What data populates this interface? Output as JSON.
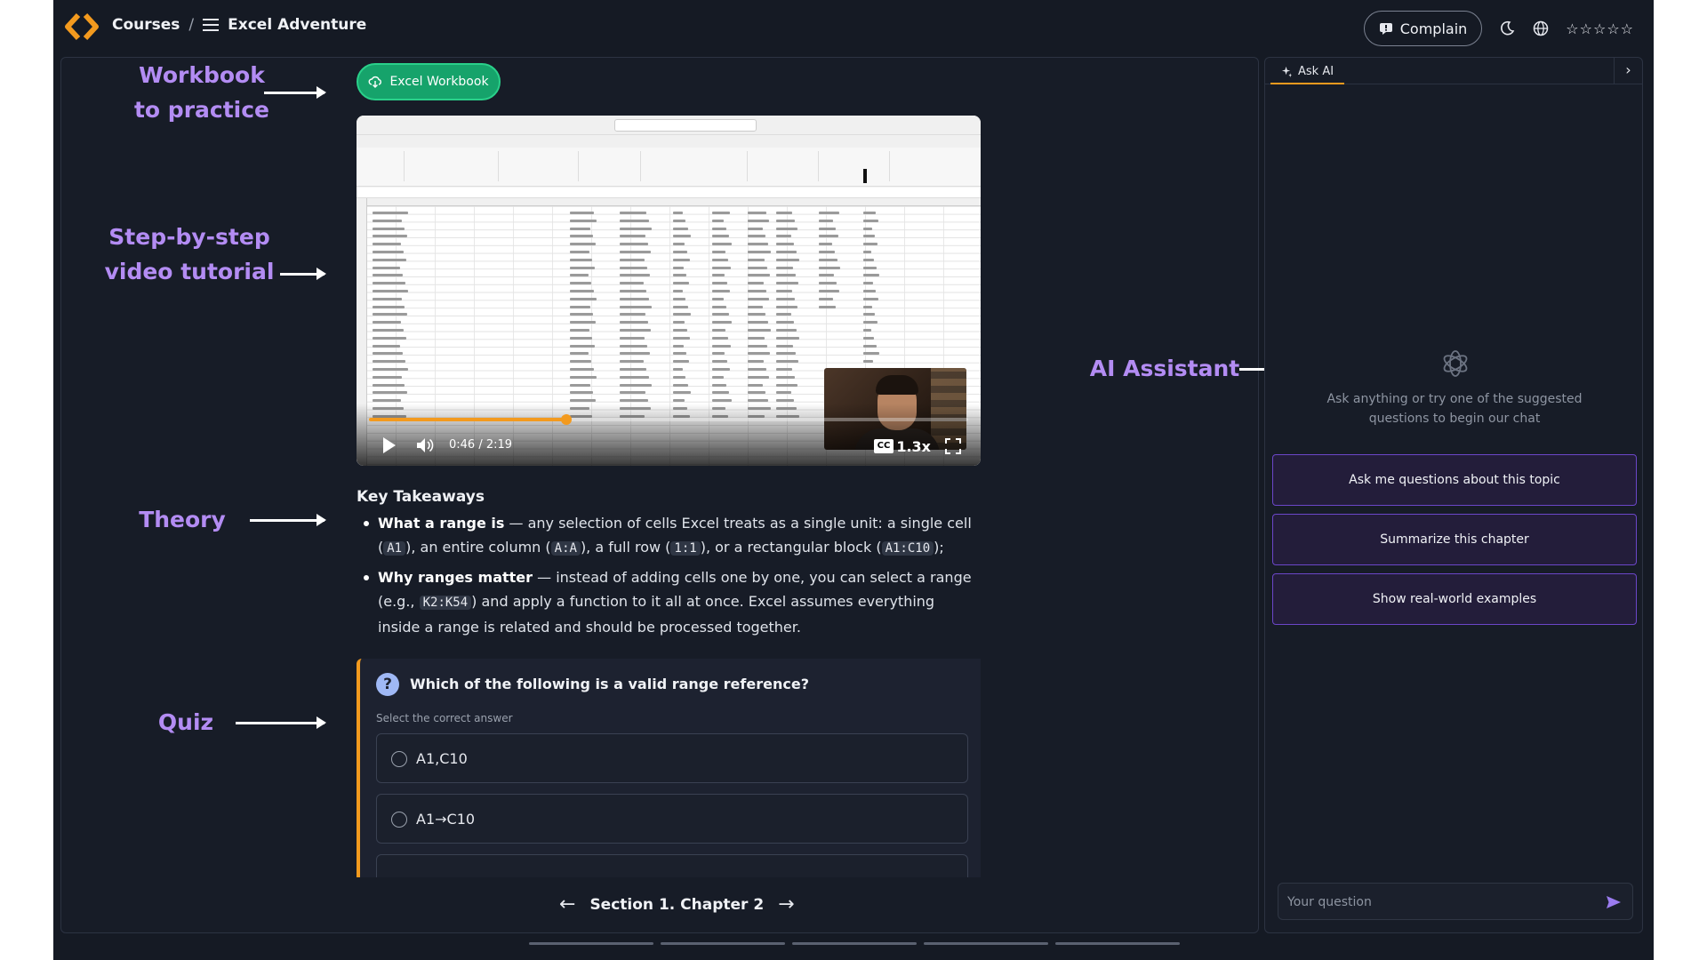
{
  "header": {
    "courses_label": "Courses",
    "separator": "/",
    "course_title": "Excel Adventure",
    "complain_label": "Complain",
    "rating_stars": "☆☆☆☆☆"
  },
  "annotations": {
    "workbook": "Workbook\nto practice",
    "video": "Step-by-step\nvideo tutorial",
    "theory": "Theory",
    "quiz": "Quiz",
    "ai": "AI Assistant"
  },
  "workbook_button": {
    "label": "Excel Workbook"
  },
  "video": {
    "current_time": "0:46",
    "separator": "/",
    "duration": "2:19",
    "progress": 0.33,
    "speed": "1.3x",
    "cc_label": "CC"
  },
  "theory": {
    "title": "Key Takeaways",
    "items": [
      {
        "bold": "What a range is",
        "t1": " — any selection of cells Excel treats as a single unit: a single cell (",
        "c1": "A1",
        "t2": "), an entire column (",
        "c2": "A:A",
        "t3": "), a full row (",
        "c3": "1:1",
        "t4": "), or a rectangular block (",
        "c4": "A1:C10",
        "t5": ");"
      },
      {
        "bold": "Why ranges matter",
        "t1": " — instead of adding cells one by one, you can select a range (e.g., ",
        "c1": "K2:K54",
        "t2": ") and apply a function to it all at once. Excel assumes everything inside a range is related and should be processed together."
      }
    ]
  },
  "quiz": {
    "icon": "?",
    "question": "Which of the following is a valid range reference?",
    "hint": "Select the correct answer",
    "options": [
      "A1,C10",
      "A1→C10"
    ]
  },
  "chapter_nav": {
    "label": "Section 1. Chapter 2",
    "prev": "←",
    "next": "→"
  },
  "ai_panel": {
    "tab_label": "Ask AI",
    "collapse": "›",
    "intro": "Ask anything or try one of the suggested questions to begin our chat",
    "suggestions": [
      "Ask me questions about this topic",
      "Summarize this chapter",
      "Show real-world examples"
    ],
    "input_placeholder": "Your question"
  },
  "colors": {
    "accent": "#f39a1e",
    "annotation": "#b38cf3",
    "workbook_green": "#16a36b",
    "suggestion_border": "#6b46c8"
  },
  "icons": {
    "logo": "code-brackets-logo",
    "menu": "hamburger-icon",
    "complain": "message-alert-icon",
    "theme": "moon-icon",
    "language": "globe-icon",
    "ai_tab": "sparkle-icon",
    "ai_logo": "openai-logo",
    "send": "send-icon"
  }
}
